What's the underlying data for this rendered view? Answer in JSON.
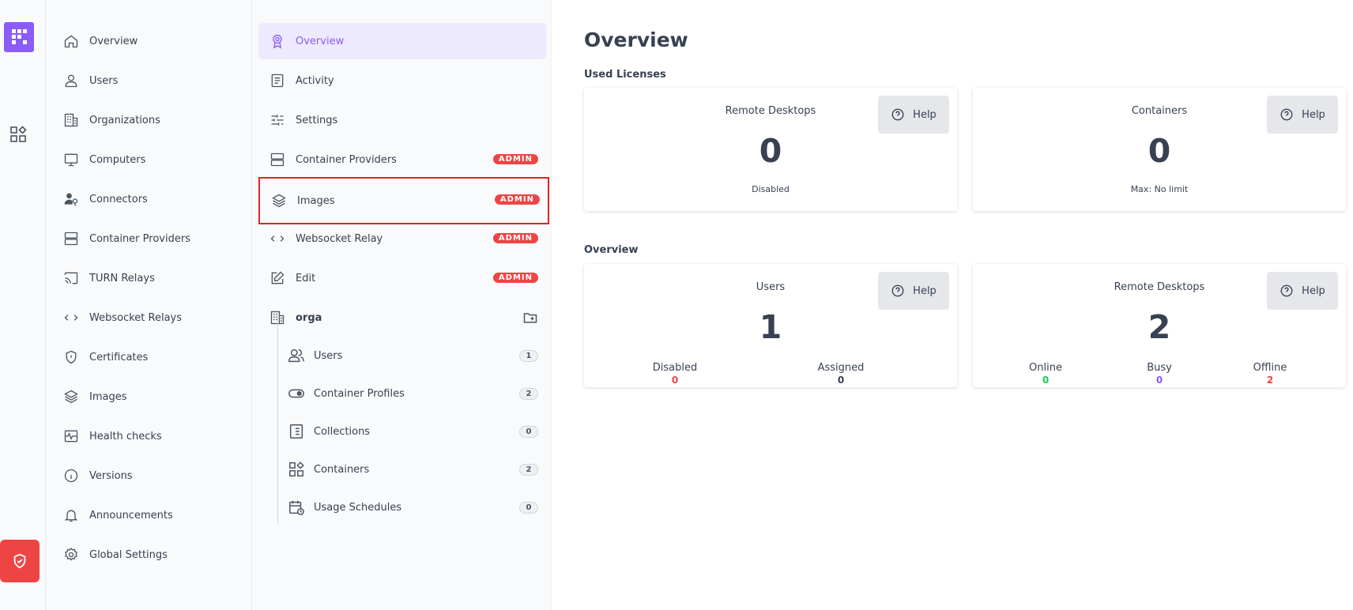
{
  "nav": {
    "items": [
      {
        "label": "Overview",
        "icon": "home-icon"
      },
      {
        "label": "Users",
        "icon": "user-icon"
      },
      {
        "label": "Organizations",
        "icon": "building-icon"
      },
      {
        "label": "Computers",
        "icon": "monitor-icon"
      },
      {
        "label": "Connectors",
        "icon": "user-key-icon"
      },
      {
        "label": "Container Providers",
        "icon": "server-icon"
      },
      {
        "label": "TURN Relays",
        "icon": "cast-icon"
      },
      {
        "label": "Websocket Relays",
        "icon": "code-arrows-icon"
      },
      {
        "label": "Certificates",
        "icon": "shield-icon"
      },
      {
        "label": "Images",
        "icon": "layers-icon"
      },
      {
        "label": "Health checks",
        "icon": "activity-icon"
      },
      {
        "label": "Versions",
        "icon": "info-icon"
      },
      {
        "label": "Announcements",
        "icon": "bell-icon"
      },
      {
        "label": "Global Settings",
        "icon": "gear-icon"
      }
    ]
  },
  "subnav": {
    "items": [
      {
        "label": "Overview",
        "badge": ""
      },
      {
        "label": "Activity",
        "badge": ""
      },
      {
        "label": "Settings",
        "badge": ""
      },
      {
        "label": "Container Providers",
        "badge": "ADMIN"
      },
      {
        "label": "Images",
        "badge": "ADMIN"
      },
      {
        "label": "Websocket Relay",
        "badge": "ADMIN"
      },
      {
        "label": "Edit",
        "badge": "ADMIN"
      }
    ],
    "org": {
      "name": "orga",
      "children": [
        {
          "label": "Users",
          "count": "1"
        },
        {
          "label": "Container Profiles",
          "count": "2"
        },
        {
          "label": "Collections",
          "count": "0"
        },
        {
          "label": "Containers",
          "count": "2"
        },
        {
          "label": "Usage Schedules",
          "count": "0"
        }
      ]
    }
  },
  "main": {
    "title": "Overview",
    "help_label": "Help",
    "licenses": {
      "title": "Used Licenses",
      "cards": [
        {
          "title": "Remote Desktops",
          "value": "0",
          "sub": "Disabled"
        },
        {
          "title": "Containers",
          "value": "0",
          "sub": "Max: No limit"
        }
      ]
    },
    "overview": {
      "title": "Overview",
      "users": {
        "title": "Users",
        "value": "1",
        "stats": [
          {
            "label": "Disabled",
            "value": "0"
          },
          {
            "label": "Assigned",
            "value": "0"
          }
        ]
      },
      "desktops": {
        "title": "Remote Desktops",
        "value": "2",
        "stats": [
          {
            "label": "Online",
            "value": "0"
          },
          {
            "label": "Busy",
            "value": "0"
          },
          {
            "label": "Offline",
            "value": "2"
          }
        ]
      }
    }
  },
  "colors": {
    "accent": "#8b5cf6",
    "danger": "#ef4444",
    "success": "#22c55e",
    "active_bg": "#ede9fe"
  }
}
